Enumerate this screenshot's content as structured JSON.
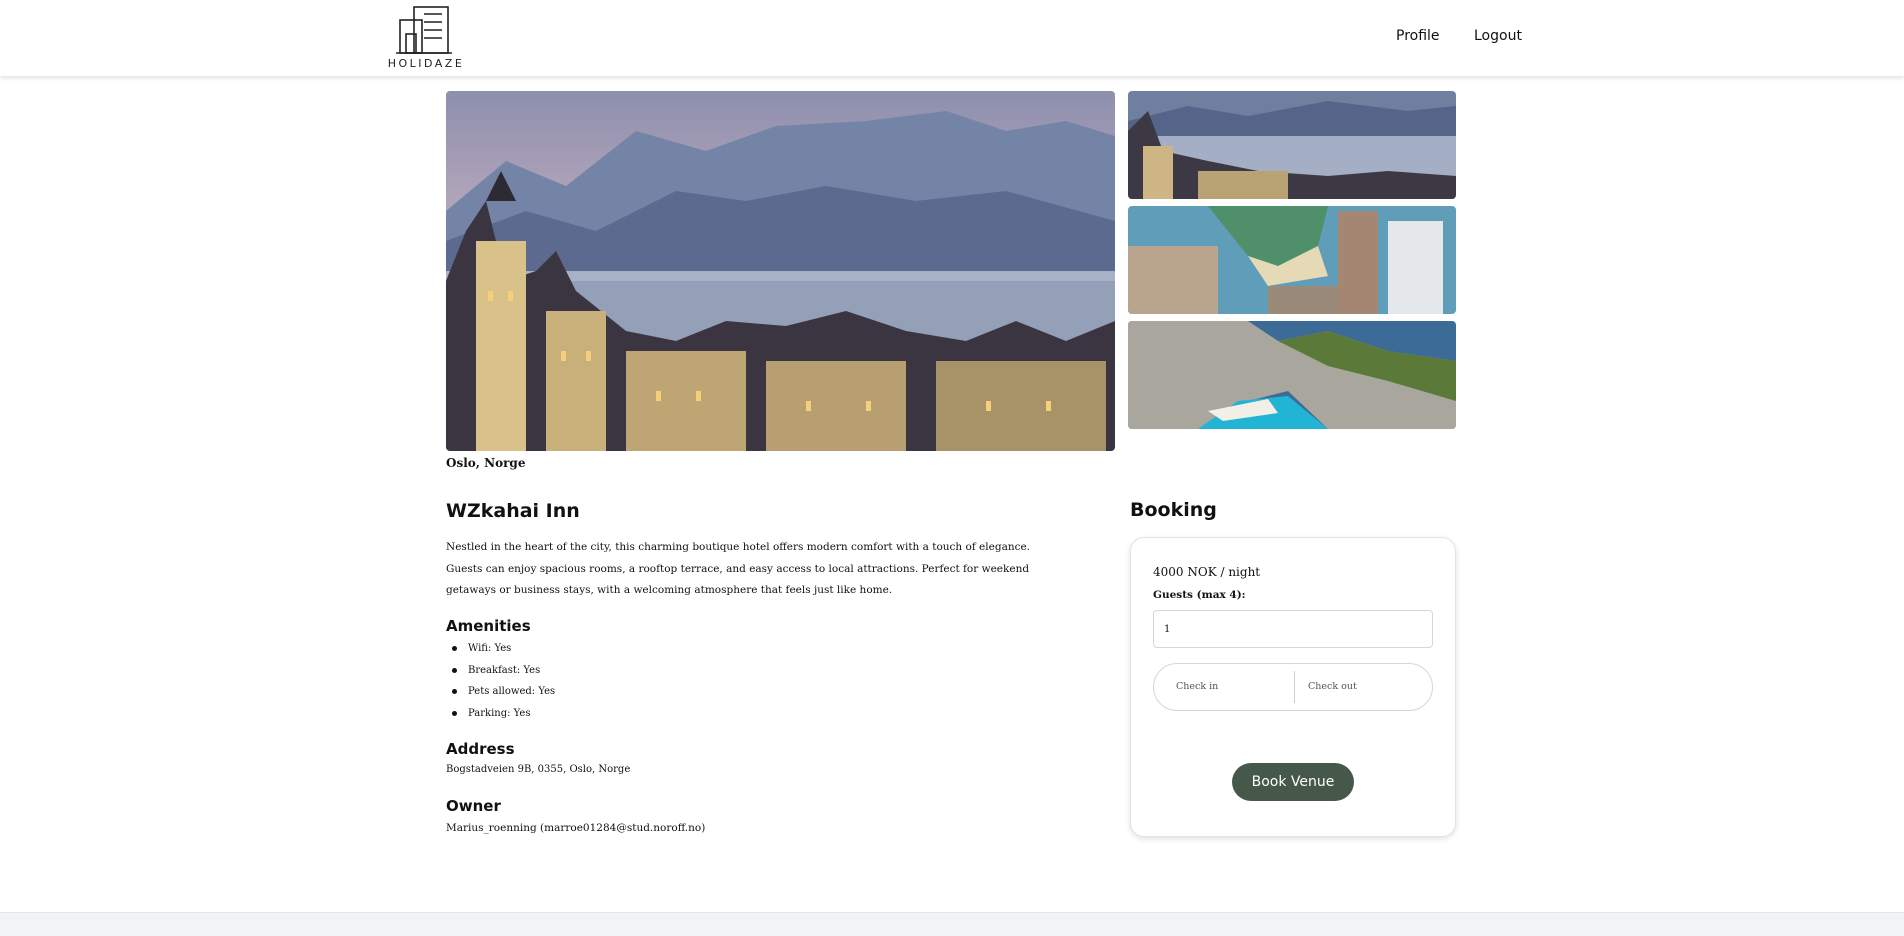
{
  "header": {
    "logo_text": "HOLIDAZE",
    "nav": {
      "profile": "Profile",
      "logout": "Logout"
    }
  },
  "gallery": {
    "main_image": "castle-lake-mountains-image",
    "thumbnails": [
      "castle-lake-thumbnail",
      "coastal-city-beach-thumbnail",
      "cliff-cove-beach-thumbnail"
    ]
  },
  "venue": {
    "location": "Oslo, Norge",
    "name": "WZkahai Inn",
    "description": "Nestled in the heart of the city, this charming boutique hotel offers modern comfort with a touch of elegance. Guests can enjoy spacious rooms, a rooftop terrace, and easy access to local attractions. Perfect for weekend getaways or business stays, with a welcoming atmosphere that feels just like home.",
    "amenities_title": "Amenities",
    "amenities": [
      {
        "label": "Wifi: Yes"
      },
      {
        "label": "Breakfast: Yes"
      },
      {
        "label": "Pets allowed: Yes"
      },
      {
        "label": "Parking: Yes"
      }
    ],
    "address_title": "Address",
    "address": "Bogstadveien 9B, 0355, Oslo, Norge",
    "owner_title": "Owner",
    "owner": "Marius_roenning (marroe01284@stud.noroff.no)"
  },
  "booking": {
    "title": "Booking",
    "price": "4000 NOK / night",
    "guests_label": "Guests (max 4):",
    "guests_value": "1",
    "check_in_placeholder": "Check in",
    "check_out_placeholder": "Check out",
    "book_button": "Book Venue"
  },
  "colors": {
    "button": "#46584a",
    "footer": "#f2f3f4"
  }
}
